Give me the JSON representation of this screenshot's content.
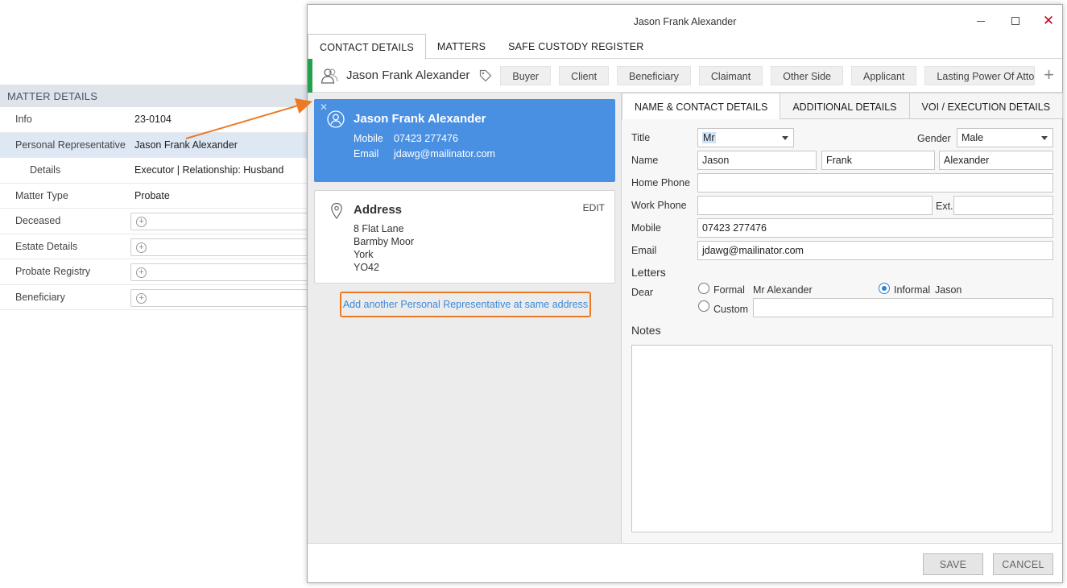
{
  "matter_details": {
    "header": "MATTER DETAILS",
    "rows": [
      {
        "label": "Info",
        "value": "23-0104"
      },
      {
        "label": "Personal Representative",
        "value": "Jason Frank Alexander"
      },
      {
        "label": "Details",
        "value": "Executor | Relationship: Husband"
      },
      {
        "label": "Matter Type",
        "value": "Probate"
      },
      {
        "label": "Deceased",
        "value": ""
      },
      {
        "label": "Estate Details",
        "value": ""
      },
      {
        "label": "Probate Registry",
        "value": ""
      },
      {
        "label": "Beneficiary",
        "value": ""
      }
    ],
    "add_icon": "plus-circle-icon"
  },
  "window": {
    "title": "Jason Frank Alexander",
    "close_glyph": "✕"
  },
  "top_tabs": [
    "CONTACT DETAILS",
    "MATTERS",
    "SAFE CUSTODY REGISTER"
  ],
  "role_bar": {
    "name": "Jason Frank Alexander",
    "roles": [
      "Buyer",
      "Client",
      "Beneficiary",
      "Claimant",
      "Other Side",
      "Applicant",
      "Lasting Power Of Attorney"
    ],
    "add_glyph": "+",
    "accent_color": "#23a24d"
  },
  "contact_card": {
    "close_glyph": "✕",
    "name": "Jason Frank Alexander",
    "mobile_label": "Mobile",
    "mobile": "07423 277476",
    "email_label": "Email",
    "email": "jdawg@mailinator.com",
    "color": "#4a90e2"
  },
  "address_card": {
    "title": "Address",
    "edit_label": "EDIT",
    "lines": [
      "8 Flat Lane",
      "Barmby Moor",
      "York",
      "YO42"
    ]
  },
  "add_another_link": "Add another Personal Representative at same address",
  "sub_tabs": [
    "NAME & CONTACT DETAILS",
    "ADDITIONAL DETAILS",
    "VOI / EXECUTION DETAILS"
  ],
  "form": {
    "title_label": "Title",
    "title_value": "Mr",
    "gender_label": "Gender",
    "gender_value": "Male",
    "name_label": "Name",
    "first_name": "Jason",
    "middle_name": "Frank",
    "last_name": "Alexander",
    "home_phone_label": "Home Phone",
    "home_phone": "",
    "work_phone_label": "Work Phone",
    "work_phone": "",
    "ext_label": "Ext.",
    "ext": "",
    "mobile_label": "Mobile",
    "mobile": "07423 277476",
    "email_label": "Email",
    "email": "jdawg@mailinator.com",
    "letters_heading": "Letters",
    "dear_label": "Dear",
    "formal_label": "Formal",
    "formal_value": "Mr Alexander",
    "informal_label": "Informal",
    "informal_value": "Jason",
    "custom_label": "Custom",
    "custom_value": "",
    "notes_heading": "Notes",
    "notes_value": ""
  },
  "footer": {
    "save_label": "SAVE",
    "cancel_label": "CANCEL"
  },
  "annotation_color": "#ec7a24"
}
